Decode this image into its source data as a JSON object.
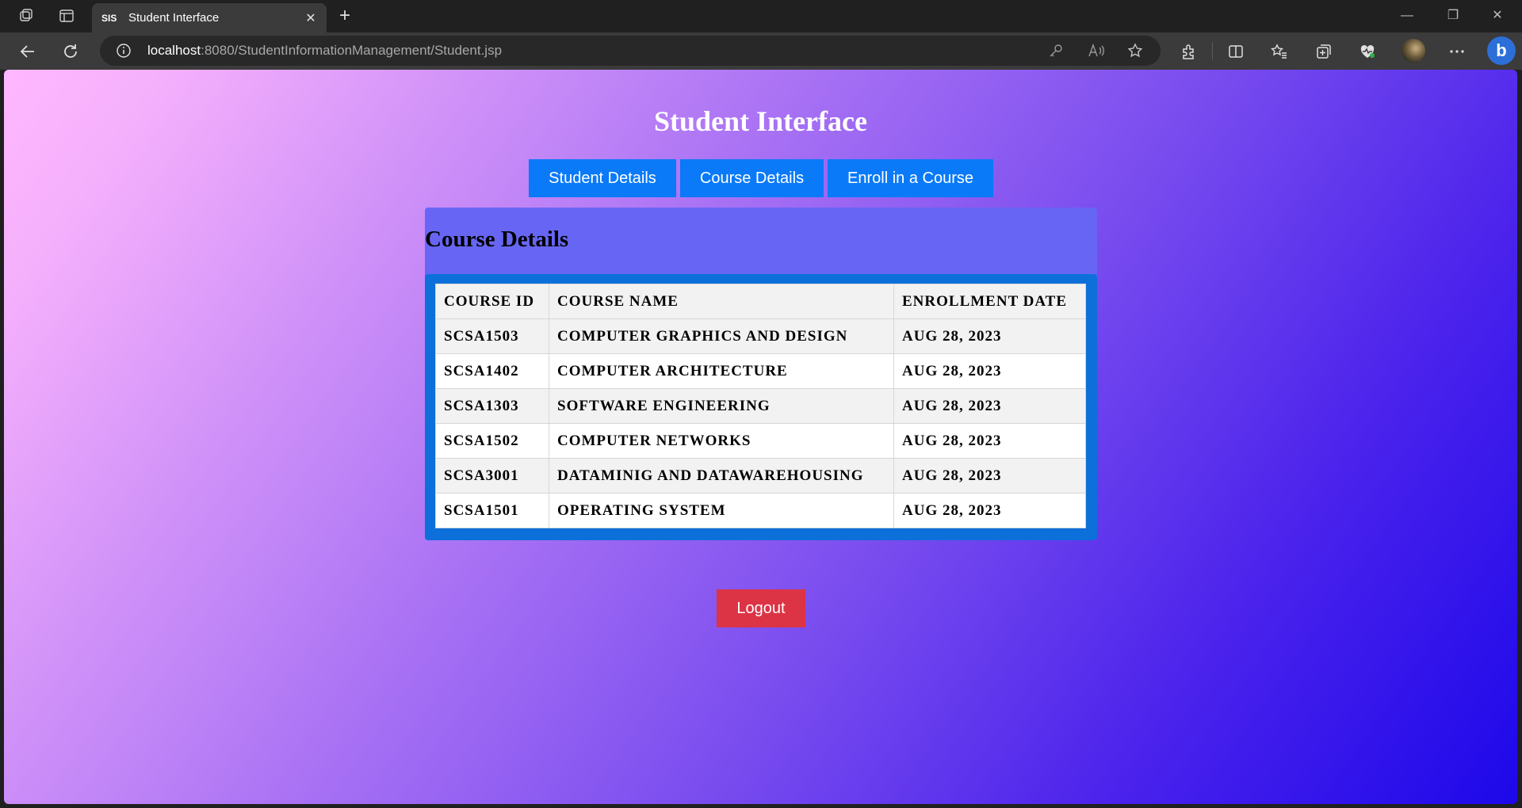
{
  "browser": {
    "tab_favicon": "SIS",
    "tab_title": "Student Interface",
    "url_host": "localhost",
    "url_rest": ":8080/StudentInformationManagement/Student.jsp"
  },
  "page": {
    "title": "Student Interface",
    "nav": {
      "student_details": "Student Details",
      "course_details": "Course Details",
      "enroll": "Enroll in a Course"
    },
    "panel_title": "Course Details",
    "table": {
      "headers": [
        "COURSE ID",
        "COURSE NAME",
        "ENROLLMENT DATE"
      ],
      "rows": [
        [
          "SCSA1503",
          "COMPUTER GRAPHICS AND DESIGN",
          "AUG 28, 2023"
        ],
        [
          "SCSA1402",
          "COMPUTER ARCHITECTURE",
          "AUG 28, 2023"
        ],
        [
          "SCSA1303",
          "SOFTWARE ENGINEERING",
          "AUG 28, 2023"
        ],
        [
          "SCSA1502",
          "COMPUTER NETWORKS",
          "AUG 28, 2023"
        ],
        [
          "SCSA3001",
          "DATAMINIG AND DATAWAREHOUSING",
          "AUG 28, 2023"
        ],
        [
          "SCSA1501",
          "OPERATING SYSTEM",
          "AUG 28, 2023"
        ]
      ]
    },
    "logout": "Logout"
  },
  "colors": {
    "nav_button": "#0a7af8",
    "logout_button": "#dc3445",
    "panel": "#6766f4",
    "table_frame": "#0d6fda"
  }
}
